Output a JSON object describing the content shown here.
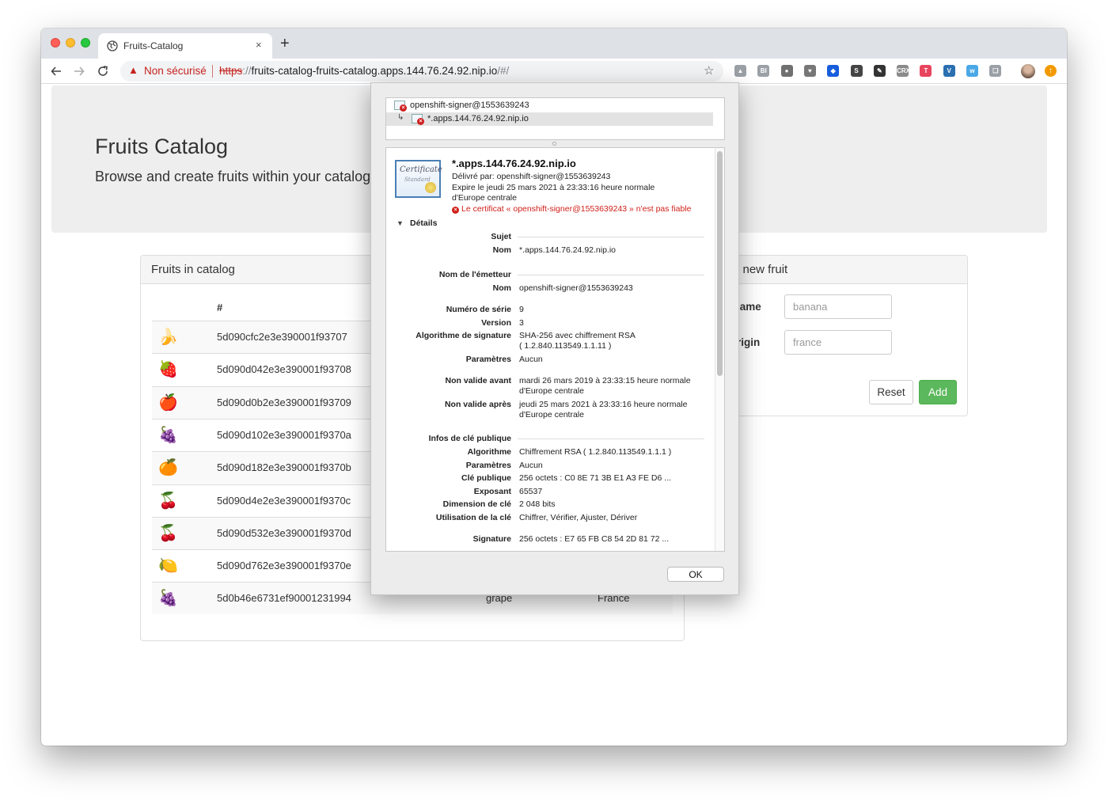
{
  "browser": {
    "tab_title": "Fruits-Catalog",
    "tab_close": "×",
    "new_tab": "+",
    "security_label": "Non sécurisé",
    "url_scheme": "https",
    "url_sep": "://",
    "url_host": "fruits-catalog-fruits-catalog.apps.144.76.24.92.nip.io",
    "url_path": "/#/",
    "extensions": [
      {
        "name": "google-drive-icon",
        "glyph": "▲",
        "color": "#9aa0a6"
      },
      {
        "name": "bi-extension-icon",
        "glyph": "BI",
        "color": "#9aa0a6"
      },
      {
        "name": "circle-extension-icon",
        "glyph": "●",
        "color": "#707070"
      },
      {
        "name": "pocket-icon",
        "glyph": "♥",
        "color": "#777777"
      },
      {
        "name": "bitwarden-icon",
        "glyph": "◆",
        "color": "#175ddc"
      },
      {
        "name": "s-extension-icon",
        "glyph": "S",
        "color": "#444444"
      },
      {
        "name": "pin-extension-icon",
        "glyph": "✎",
        "color": "#333333"
      },
      {
        "name": "crx-extension-icon",
        "glyph": "CRX",
        "color": "#8a8a8a"
      },
      {
        "name": "t-extension-icon",
        "glyph": "T",
        "color": "#e8445e"
      },
      {
        "name": "vue-devtools-icon",
        "glyph": "V",
        "color": "#2a6fb0"
      },
      {
        "name": "wappalyzer-icon",
        "glyph": "w",
        "color": "#4aa8e6"
      },
      {
        "name": "notes-extension-icon",
        "glyph": "❏",
        "color": "#9aa0a6"
      }
    ]
  },
  "page": {
    "title": "Fruits Catalog",
    "subtitle": "Browse and create fruits within your catalog",
    "list_panel": {
      "title": "Fruits in catalog",
      "header_hash": "#",
      "rows": [
        {
          "icon": "🍌",
          "icon_name": "banana-icon",
          "id": "5d090cfc2e3e390001f93707",
          "name": "",
          "origin": ""
        },
        {
          "icon": "🍓",
          "icon_name": "strawberry-icon",
          "id": "5d090d042e3e390001f93708",
          "name": "",
          "origin": ""
        },
        {
          "icon": "🍎",
          "icon_name": "apple-icon",
          "id": "5d090d0b2e3e390001f93709",
          "name": "",
          "origin": ""
        },
        {
          "icon": "🍇",
          "icon_name": "grapes-icon",
          "id": "5d090d102e3e390001f9370a",
          "name": "",
          "origin": ""
        },
        {
          "icon": "🍊",
          "icon_name": "orange-icon",
          "id": "5d090d182e3e390001f9370b",
          "name": "",
          "origin": ""
        },
        {
          "icon": "🍒",
          "icon_name": "cherries-icon",
          "id": "5d090d4e2e3e390001f9370c",
          "name": "",
          "origin": ""
        },
        {
          "icon": "🍒",
          "icon_name": "cherries-icon",
          "id": "5d090d532e3e390001f9370d",
          "name": "",
          "origin": ""
        },
        {
          "icon": "🍋",
          "icon_name": "lemon-icon",
          "id": "5d090d762e3e390001f9370e",
          "name": "",
          "origin": ""
        },
        {
          "icon": "🍇",
          "icon_name": "grapes-icon",
          "id": "5d0b46e6731ef90001231994",
          "name": "grape",
          "origin": "France"
        }
      ]
    },
    "add_panel": {
      "title": "l new fruit",
      "name_label": "lame",
      "name_placeholder": "banana",
      "origin_label": "rigin",
      "origin_placeholder": "france",
      "reset_label": "Reset",
      "add_label": "Add"
    }
  },
  "cert_dialog": {
    "chain": [
      {
        "label": "openshift-signer@1553639243"
      },
      {
        "label": "*.apps.144.76.24.92.nip.io"
      }
    ],
    "badge_text": "Certificate",
    "badge_sub": "Standard",
    "subject_cn": "*.apps.144.76.24.92.nip.io",
    "issued_by": "Délivré par: openshift-signer@1553639243",
    "expires_1": "Expire le jeudi 25 mars 2021 à 23:33:16 heure normale",
    "expires_2": "d'Europe centrale",
    "trust_error": "Le certificat « openshift-signer@1553639243 » n'est pas fiable",
    "details_label": "Détails",
    "subject_section": "Sujet",
    "name_key": "Nom",
    "subject_name": "*.apps.144.76.24.92.nip.io",
    "issuer_section": "Nom de l'émetteur",
    "issuer_name": "openshift-signer@1553639243",
    "serial_key": "Numéro de série",
    "serial": "9",
    "version_key": "Version",
    "version": "3",
    "sig_alg_key": "Algorithme de signature",
    "sig_alg_1": "SHA-256 avec chiffrement RSA",
    "sig_alg_2": "( 1.2.840.113549.1.1.11 )",
    "params_key": "Paramètres",
    "params": "Aucun",
    "not_before_key": "Non valide avant",
    "not_before_1": "mardi 26 mars 2019 à 23:33:15 heure normale",
    "not_before_2": "d'Europe centrale",
    "not_after_key": "Non valide après",
    "not_after_1": "jeudi 25 mars 2021 à 23:33:16 heure normale",
    "not_after_2": "d'Europe centrale",
    "pubkey_section": "Infos de clé publique",
    "alg_key": "Algorithme",
    "alg": "Chiffrement RSA ( 1.2.840.113549.1.1.1 )",
    "pk_params": "Aucun",
    "pubkey_key": "Clé publique",
    "pubkey": "256 octets : C0 8E 71 3B E1 A3 FE D6 ...",
    "exponent_key": "Exposant",
    "exponent": "65537",
    "keysize_key": "Dimension de clé",
    "keysize": "2 048 bits",
    "usage_key": "Utilisation de la clé",
    "usage": "Chiffrer, Vérifier, Ajuster, Dériver",
    "signature_key": "Signature",
    "signature": "256 octets : E7 65 FB C8 54 2D 81 72 ...",
    "ok_label": "OK"
  }
}
